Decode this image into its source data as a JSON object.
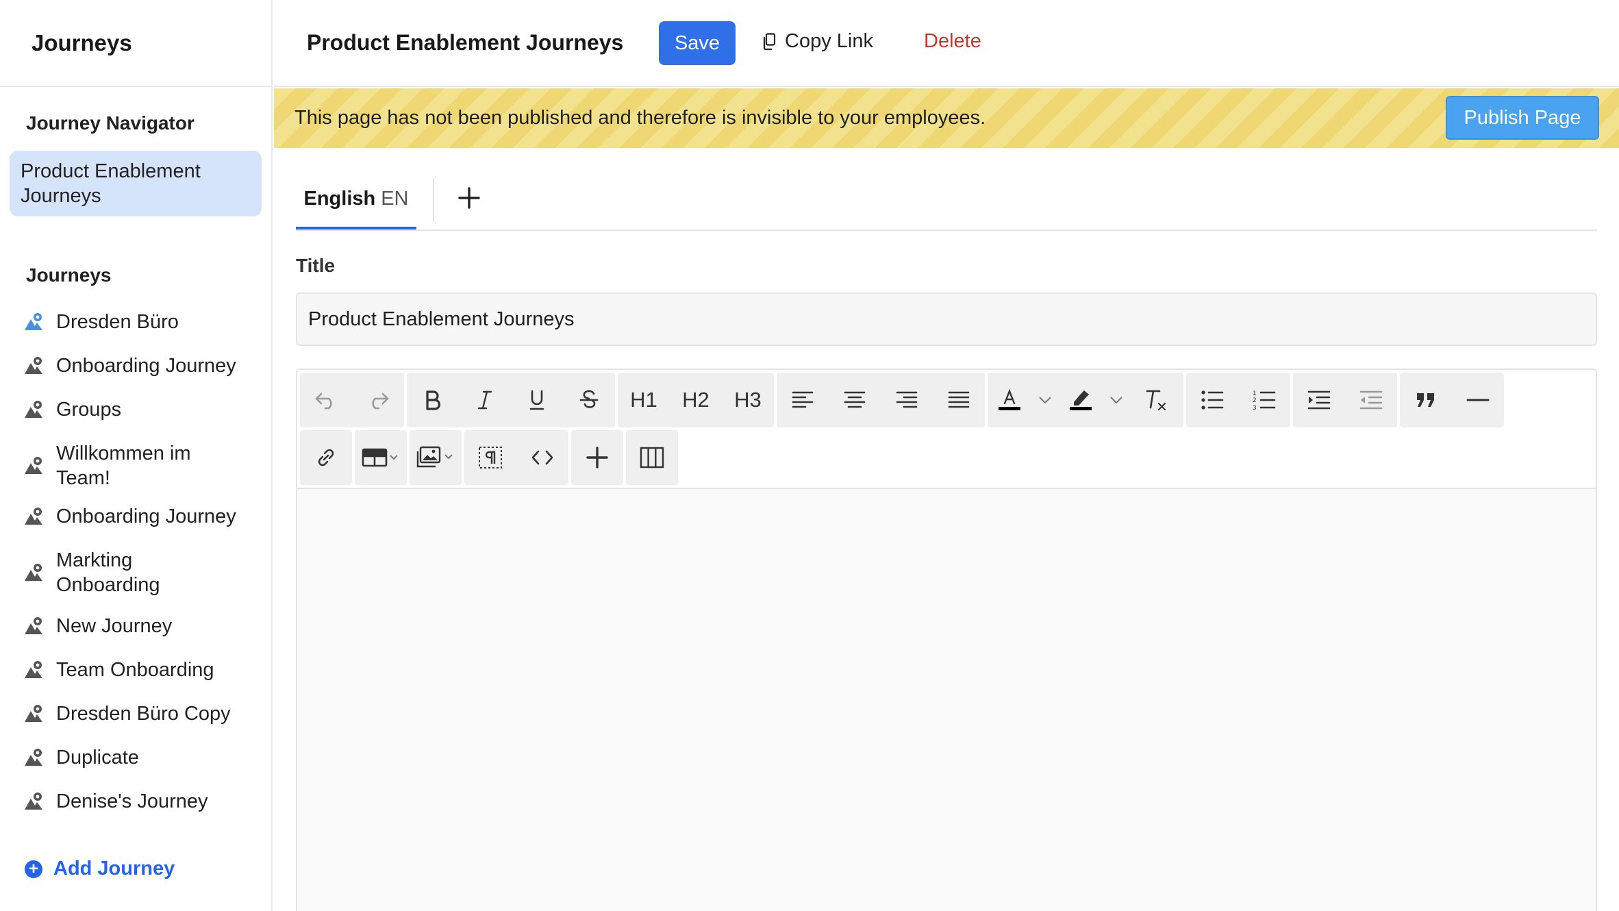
{
  "sidebar": {
    "title": "Journeys",
    "navigator_title": "Journey Navigator",
    "active_item": "Product Enablement Journeys",
    "journeys_title": "Journeys",
    "journeys": [
      "Dresden Büro",
      "Onboarding Journey",
      "Groups",
      "Willkommen im Team!",
      "Onboarding Journey",
      "Markting Onboarding",
      "New Journey",
      "Team Onboarding",
      "Dresden Büro Copy",
      "Duplicate",
      "Denise's Journey"
    ],
    "add_label": "Add Journey"
  },
  "topbar": {
    "page_title": "Product Enablement Journeys",
    "save_label": "Save",
    "copy_link_label": "Copy Link",
    "delete_label": "Delete"
  },
  "banner": {
    "text": "This page has not been published and therefore is invisible to your employees.",
    "publish_label": "Publish Page"
  },
  "tabs": {
    "language_name": "English",
    "language_code": "EN"
  },
  "form": {
    "title_label": "Title",
    "title_value": "Product Enablement Journeys"
  },
  "toolbar": {
    "h1": "H1",
    "h2": "H2",
    "h3": "H3"
  },
  "colors": {
    "accent": "#2f6fe8",
    "publish": "#4aa3f0",
    "delete": "#c0392b",
    "active_nav": "#d6e4fb",
    "banner": "#f3e28d"
  },
  "icons": {
    "journey_item": "map-pin-mountain-icon",
    "copy_link": "copy-icon",
    "tab_add": "plus-icon",
    "add_journey": "plus-circle-icon"
  }
}
